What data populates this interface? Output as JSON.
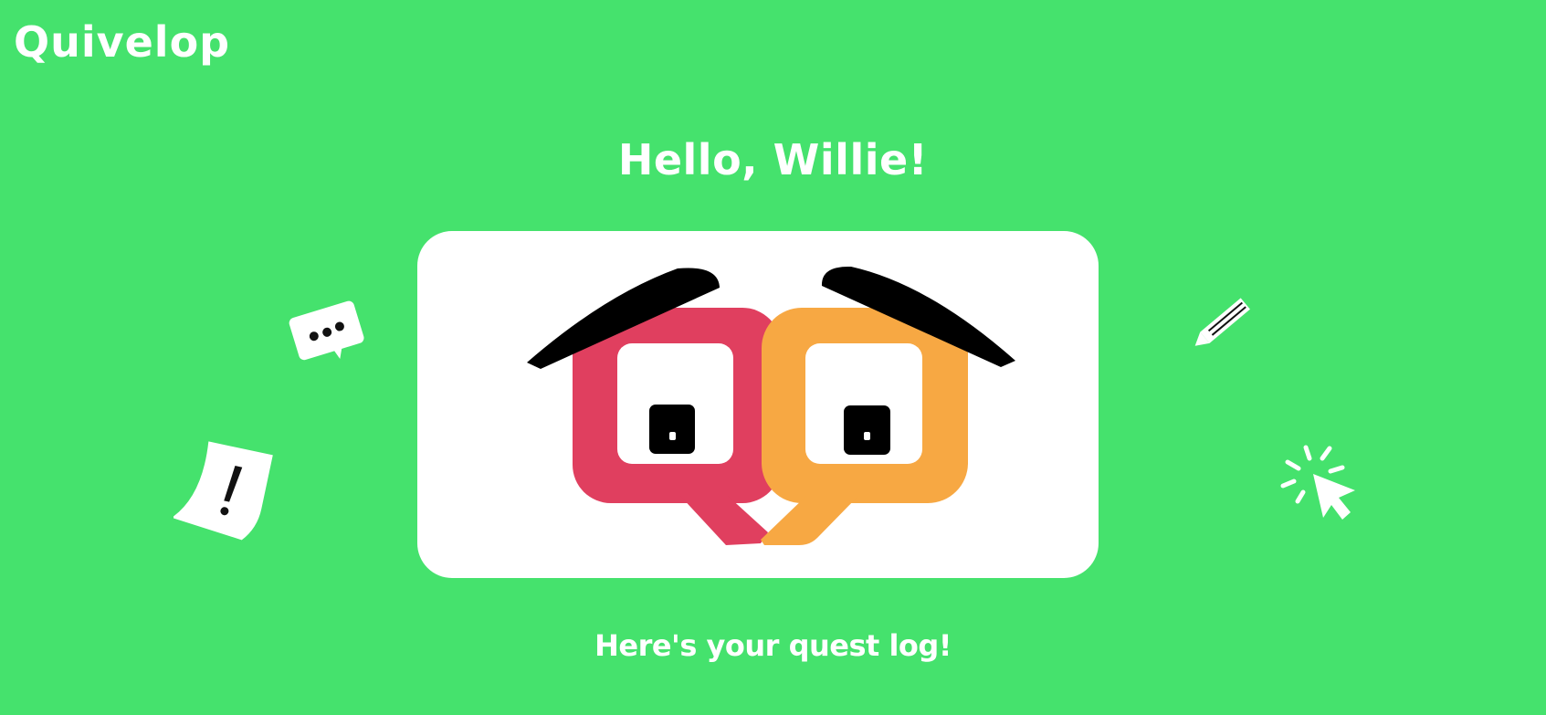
{
  "header": {
    "logo_text": "Quivelop"
  },
  "main": {
    "greeting": "Hello, Willie!",
    "subheading": "Here's your quest log!"
  },
  "mascot": {
    "icon": "quivelop-mascot-icon",
    "left_bubble_color": "#e03f5f",
    "right_bubble_color": "#f7a843"
  },
  "decorations": {
    "chat_bubble_icon": "chat-bubble-dots-icon",
    "alert_note_icon": "exclamation-note-icon",
    "pencil_icon": "pencil-icon",
    "cursor_icon": "cursor-click-icon"
  },
  "colors": {
    "background": "#45e26d",
    "text": "#ffffff",
    "card": "#ffffff"
  }
}
